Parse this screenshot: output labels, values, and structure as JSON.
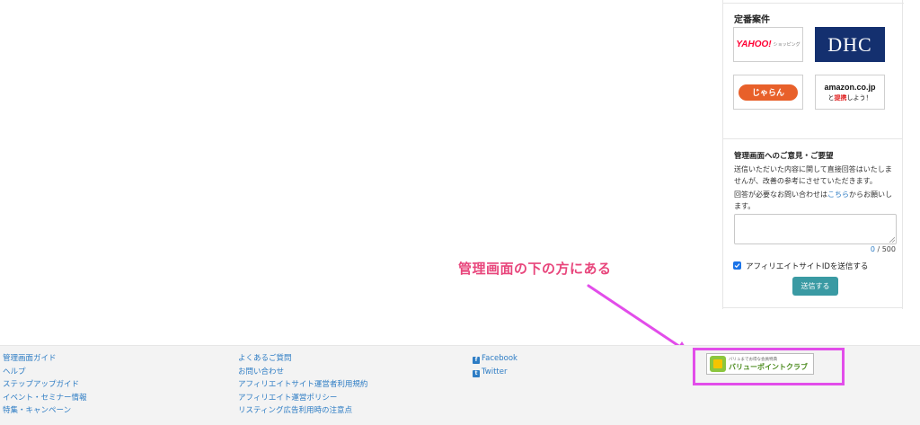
{
  "sidebar": {
    "section_title": "定番案件",
    "logos": [
      {
        "name": "Yahoo! ショッピング",
        "text_main": "YAHOO!",
        "text_sub": "ショッピング",
        "color": "#ff0033"
      },
      {
        "name": "DHC",
        "text_main": "DHC",
        "color": "#14306f"
      },
      {
        "name": "じゃらん",
        "text_main": "じゃらん",
        "color": "#e8602a"
      },
      {
        "name": "amazon.co.jp",
        "text_main": "amazon.co.jp",
        "text_sub_pre": "と",
        "text_sub_em": "提携",
        "text_sub_post": "しよう！",
        "color": "#111111"
      }
    ],
    "feedback": {
      "title": "管理画面へのご意見・ご要望",
      "desc": "送信いただいた内容に関して直接回答はいたしませんが、改善の参考にさせていただきます。",
      "reply_pre": "回答が必要なお問い合わせは",
      "reply_link": "こちら",
      "reply_post": "からお願いします。",
      "textarea_value": "",
      "counter_current": "0",
      "counter_sep": " / ",
      "counter_max": "500",
      "checkbox_label": "アフィリエイトサイトIDを送信する",
      "checkbox_checked": true,
      "submit_label": "送信する"
    }
  },
  "annotation": {
    "text": "管理画面の下の方にある",
    "color": "#e8467c",
    "arrow_color": "#e24dea"
  },
  "footer": {
    "col1": [
      "管理画面ガイド",
      "ヘルプ",
      "ステップアップガイド",
      "イベント・セミナー情報",
      "特集・キャンペーン"
    ],
    "col2": [
      "よくあるご質問",
      "お問い合わせ",
      "アフィリエイトサイト運営者利用規約",
      "アフィリエイト運営ポリシー",
      "リスティング広告利用時の注意点"
    ],
    "social": [
      {
        "icon": "facebook-icon",
        "label": "Facebook"
      },
      {
        "icon": "twitter-icon",
        "label": "Twitter"
      }
    ],
    "banner": {
      "top_text": "バリュまでお得な会員特典",
      "main_text": "バリューポイントクラブ"
    }
  },
  "colors": {
    "link": "#2d7cc4",
    "submit_button": "#3a9aa3",
    "highlight": "#e24dea",
    "footer_bg": "#f3f3f3"
  }
}
